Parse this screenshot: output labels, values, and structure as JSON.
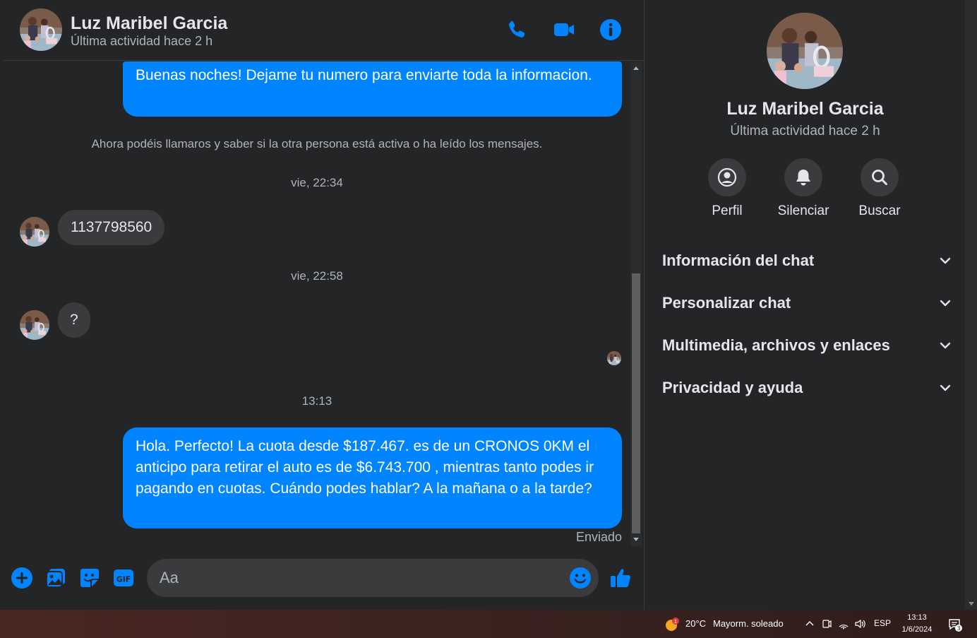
{
  "colors": {
    "accent": "#0084ff",
    "background": "#242526",
    "bubble_in": "#3a3b3c",
    "text_primary": "#e4e6eb",
    "text_secondary": "#b0b3b8"
  },
  "header": {
    "name": "Luz Maribel Garcia",
    "status": "Última actividad hace 2 h",
    "icons": [
      "phone-icon",
      "video-camera-icon",
      "info-icon"
    ]
  },
  "messages": {
    "out_first": "Buenas noches! Dejame tu numero para enviarte toda la informacion.",
    "system_note": "Ahora podéis llamaros y saber si la otra persona está activa o ha leído los mensajes.",
    "time_1": "vie, 22:34",
    "in_1": "1137798560",
    "time_2": "vie, 22:58",
    "in_2": "?",
    "time_3": "13:13",
    "out_last": "Hola. Perfecto! La cuota desde $187.467. es de un CRONOS 0KM el anticipo para retirar el auto es de $6.743.700 , mientras tanto podes ir pagando en cuotas. Cuándo podes hablar? A la mañana o a la tarde?",
    "sent_status": "Enviado"
  },
  "composer": {
    "placeholder": "Aa",
    "icons": [
      "add-icon",
      "photo-icon",
      "sticker-icon",
      "gif-icon",
      "emoji-icon",
      "like-icon"
    ],
    "gif_label": "GIF"
  },
  "info_panel": {
    "name": "Luz Maribel Garcia",
    "status": "Última actividad hace 2 h",
    "actions": [
      {
        "label": "Perfil",
        "icon": "profile-icon"
      },
      {
        "label": "Silenciar",
        "icon": "bell-icon"
      },
      {
        "label": "Buscar",
        "icon": "search-icon"
      }
    ],
    "sections": [
      {
        "title": "Información del chat"
      },
      {
        "title": "Personalizar chat"
      },
      {
        "title": "Multimedia, archivos y enlaces"
      },
      {
        "title": "Privacidad y ayuda"
      }
    ]
  },
  "taskbar": {
    "weather_badge": "1",
    "temperature": "20°C",
    "condition": "Mayorm. soleado",
    "language": "ESP",
    "time": "13:13",
    "date": "1/6/2024",
    "notification_count": "3"
  }
}
